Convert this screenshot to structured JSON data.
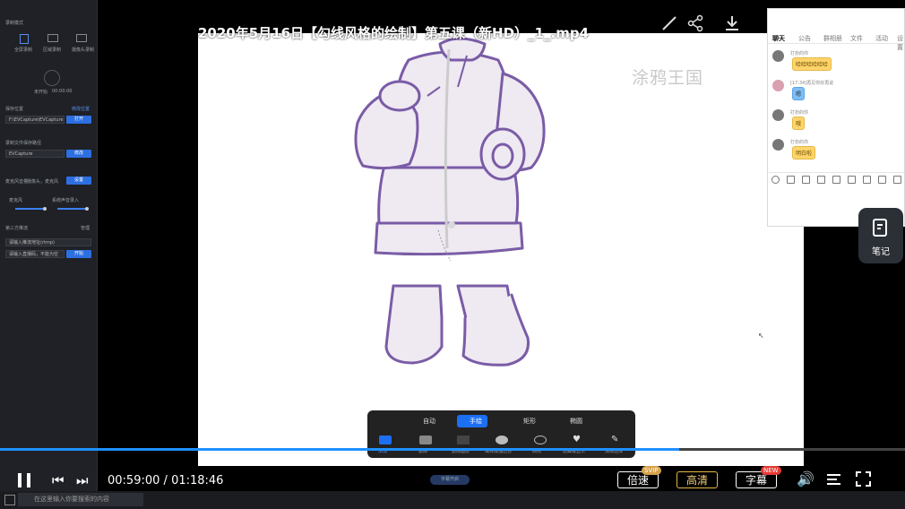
{
  "video_title": "2020年5月16日【勾线风格的绘制】第五课（新HD）_1_.mp4",
  "watermark": "涂鸦王国",
  "side_panel": {
    "section1": "录制模式",
    "modes": [
      "全屏录制",
      "区域录制",
      "摄像头录制"
    ],
    "record_label": "未开始",
    "record_time": "00:00:00",
    "save_label": "保存位置",
    "save_link": "修改位置",
    "save_path": "F:\\EVCapture\\EVCapture",
    "open_btn": "打开",
    "section_recent": "录制文件保存路径",
    "recent_value": "EVCapture",
    "modify_btn": "修改",
    "section_audio": "麦克风音量",
    "audio_value": "摄像头，麦克风",
    "audio_btn": "设置",
    "mic_label": "麦克风",
    "sys_label": "系统声音录入",
    "section_third": "第三方推流",
    "third_link": "管理",
    "third_input1": "请输入推流地址(rtmp)",
    "third_input2": "请输入直播码，不能为空",
    "start_btn": "开始"
  },
  "chat": {
    "tabs": [
      "聊天",
      "公告",
      "群相册",
      "文件",
      "活动",
      "设置"
    ],
    "messages": [
      {
        "name": "打扮的你",
        "text": "哈哈哈哈哈哈",
        "color": "yellow"
      },
      {
        "name": "[17:34]再见你好再说",
        "text": "嗯",
        "color": "blue"
      },
      {
        "name": "打扮的你",
        "text": "哦",
        "color": "yellow"
      },
      {
        "name": "打扮的你",
        "text": "明白啦",
        "color": "yellow"
      }
    ]
  },
  "notes_label": "笔记",
  "draw_toolbar": {
    "modes": [
      "自动",
      "手绘",
      "矩形",
      "椭圆"
    ],
    "active_mode": 1,
    "tools": [
      "添加",
      "删除",
      "删除图层",
      "填充或描边色",
      "高亮",
      "隐藏或显示",
      "清除选择"
    ]
  },
  "player": {
    "current_time": "00:59:00",
    "separator": "/",
    "total_time": "01:18:46",
    "progress": 0.75,
    "speed_label": "倍速",
    "speed_badge": "SVIP",
    "quality_label": "高清",
    "subtitle_label": "字幕",
    "subtitle_badge": "NEW",
    "sub_pill": "字幕开启"
  },
  "taskbar": {
    "search_placeholder": "在这里输入你要搜索的内容"
  },
  "colors": {
    "accent": "#1e90ff",
    "line_art": "#7a5ca6",
    "fill": "#efe9f2"
  }
}
